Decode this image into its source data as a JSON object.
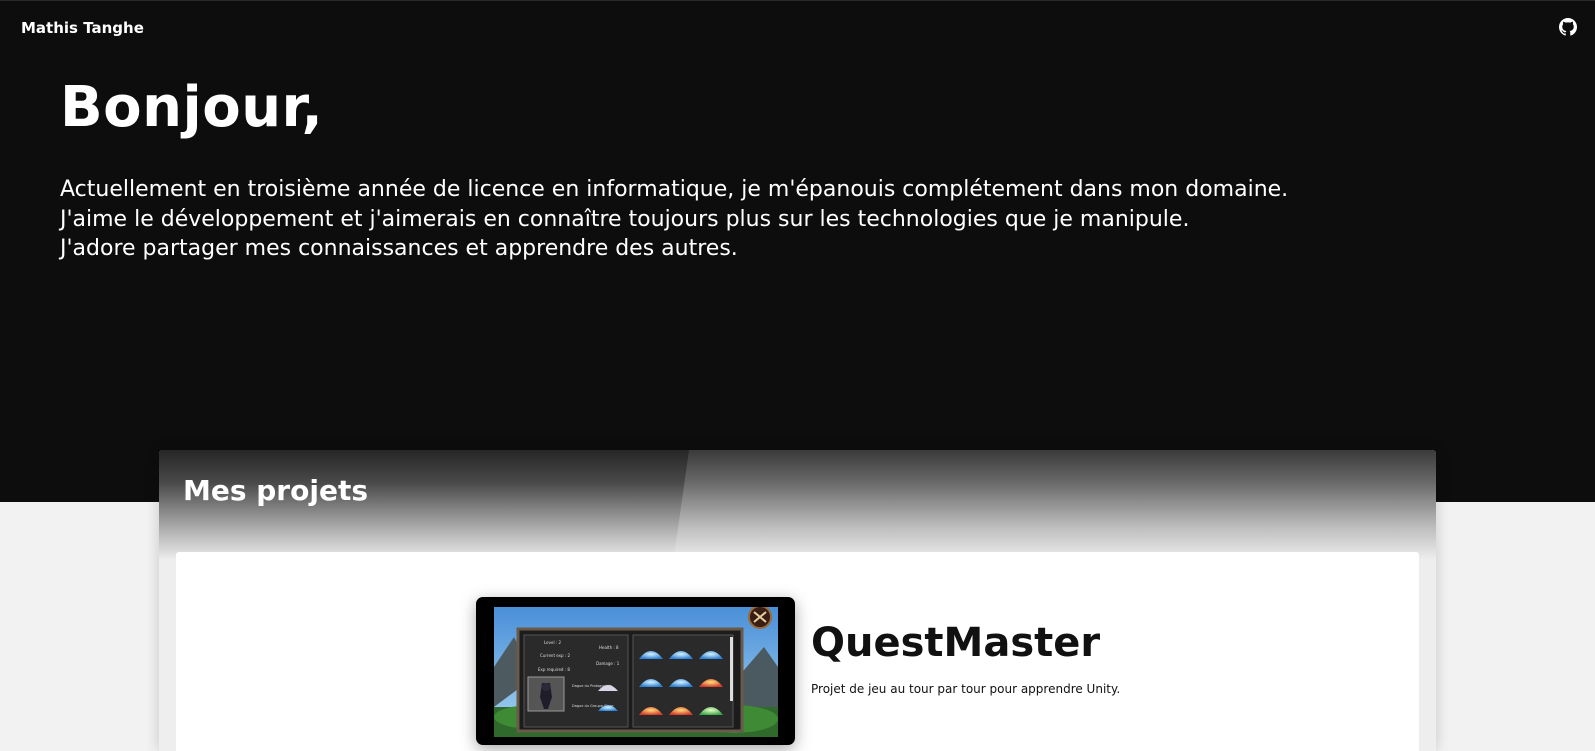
{
  "nav": {
    "brand": "Mathis Tanghe",
    "github_icon": "github-icon"
  },
  "hero": {
    "title": "Bonjour,",
    "lines": [
      "Actuellement en troisième année de licence en informatique, je m'épanouis complétement dans mon domaine.",
      "J'aime le développement et j'aimerais en connaître toujours plus sur les technologies que je manipule.",
      "J'adore partager mes connaissances et apprendre des autres."
    ]
  },
  "projects": {
    "title": "Mes projets",
    "items": [
      {
        "name": "QuestMaster",
        "description": "Projet de jeu au tour par tour pour apprendre Unity.",
        "image_labels": {
          "level": "Level : 2",
          "health": "Health : 8",
          "current_xp": "Current exp : 2",
          "damage": "Damage : 1",
          "exp_required": "Exp required : 8",
          "spell_1": "Dague du Protagoniste",
          "spell_2": "Dague du Groupe Close"
        }
      }
    ]
  },
  "colors": {
    "hero_bg": "#0d0d0d",
    "page_bg": "#f2f2f2",
    "card_bg": "#ffffff",
    "text_light": "#ffffff",
    "text_dark": "#111111"
  }
}
